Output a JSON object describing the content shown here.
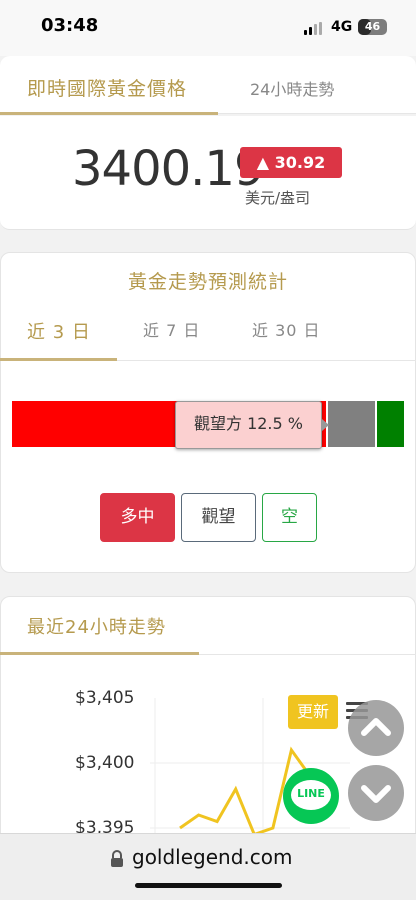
{
  "status_bar": {
    "time": "03:48",
    "network": "4G",
    "battery": "46",
    "battery_level": 0.46
  },
  "price_panel": {
    "tabs": [
      {
        "label": "即時國際黃金價格",
        "active": true
      },
      {
        "label": "24小時走勢",
        "active": false
      }
    ],
    "price": "3400.19",
    "change": "▲ 30.92",
    "unit": "美元/盎司"
  },
  "forecast": {
    "title": "黃金走勢預測統計",
    "tabs": [
      {
        "label": "近 3 日",
        "active": true
      },
      {
        "label": "近 7 日",
        "active": false
      },
      {
        "label": "近 30 日",
        "active": false
      }
    ],
    "segments": [
      {
        "name": "多",
        "share": 0.8,
        "color": "#ff0000"
      },
      {
        "name": "觀望方",
        "share": 0.125,
        "color": "#808080"
      },
      {
        "name": "空",
        "share": 0.075,
        "color": "#008000"
      }
    ],
    "tooltip": "觀望方 12.5 %",
    "buttons": {
      "long": "多中",
      "watch": "觀望",
      "short": "空"
    }
  },
  "trend": {
    "title": "最近24小時走勢",
    "y_ticks": [
      "$3,405",
      "$3,400",
      "$3,395"
    ],
    "update_label": "更新",
    "line_label": "LINE"
  },
  "chart_data": {
    "type": "line",
    "title": "",
    "xlabel": "",
    "ylabel": "",
    "ylim": [
      3395,
      3405
    ],
    "y_ticks": [
      "$3,405",
      "$3,400",
      "$3,395"
    ],
    "series": [
      {
        "x": [
          0,
          1,
          2,
          3,
          4,
          5,
          6,
          7
        ],
        "values": [
          3395,
          3396,
          3395.5,
          3398,
          3394.5,
          3395,
          3401,
          3399
        ]
      }
    ],
    "grid": true,
    "color": "#f0c420"
  },
  "browser": {
    "url": "goldlegend.com"
  },
  "colors": {
    "gold_accent": "#b59a4e",
    "up_red": "#dc3545",
    "short_green": "#28a745"
  }
}
